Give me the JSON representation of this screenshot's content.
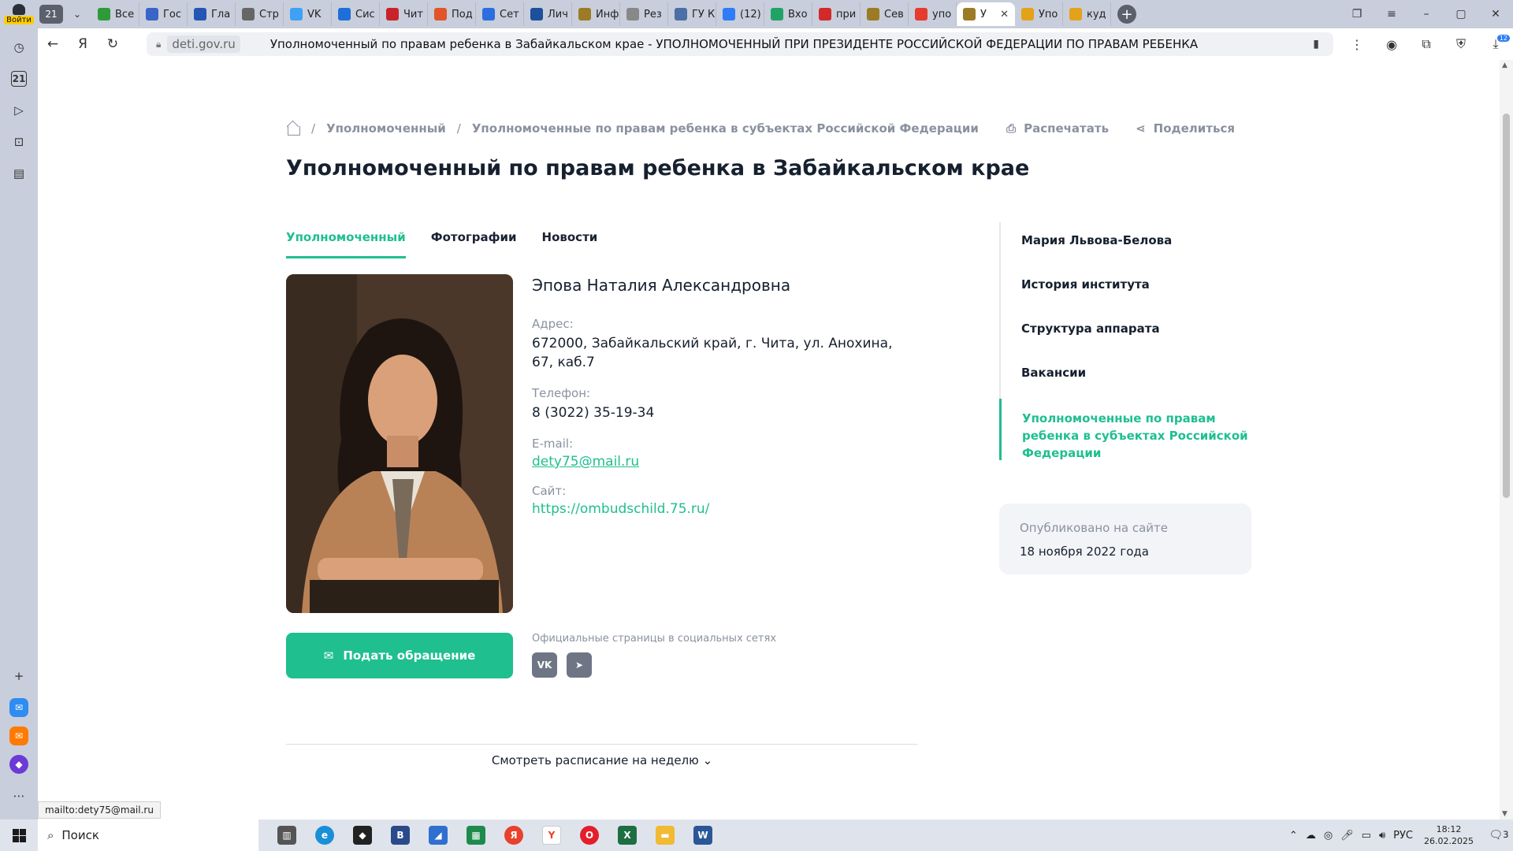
{
  "browser": {
    "login_label": "Войти",
    "tab_count": "21",
    "tabs": [
      {
        "label": "Все",
        "color": "#2d9b3a"
      },
      {
        "label": "Гос",
        "color": "#3a64c8"
      },
      {
        "label": "Гла",
        "color": "#2356b5"
      },
      {
        "label": "Стр",
        "color": "#666666"
      },
      {
        "label": "VK",
        "color": "#3da2f5"
      },
      {
        "label": "Сис",
        "color": "#1e6fd9"
      },
      {
        "label": "Чит",
        "color": "#c8232c"
      },
      {
        "label": "Под",
        "color": "#e2542a"
      },
      {
        "label": "Сет",
        "color": "#2c6ee0"
      },
      {
        "label": "Лич",
        "color": "#1d4f9c"
      },
      {
        "label": "Инф",
        "color": "#9c7b26"
      },
      {
        "label": "Рез",
        "color": "#888888"
      },
      {
        "label": "ГУ К",
        "color": "#4b6fa6"
      },
      {
        "label": "(12)",
        "color": "#2f7cf6"
      },
      {
        "label": "Вхо",
        "color": "#21a366"
      },
      {
        "label": "при",
        "color": "#d22a2a"
      },
      {
        "label": "Сев",
        "color": "#9c7b26"
      },
      {
        "label": "упо",
        "color": "#e63a2e"
      }
    ],
    "active_tab": {
      "label": "У"
    },
    "tabs_after": [
      {
        "label": "Упо",
        "color": "#e3a21a"
      },
      {
        "label": "куд",
        "color": "#e3a21a"
      }
    ],
    "domain": "deti.gov.ru",
    "page_title": "Уполномоченный по правам ребенка в Забайкальском крае - УПОЛНОМОЧЕННЫЙ ПРИ ПРЕЗИДЕНТЕ РОССИЙСКОЙ ФЕДЕРАЦИИ ПО ПРАВАМ РЕБЕНКА",
    "downloads_badge": "12",
    "status_url": "mailto:dety75@mail.ru",
    "sidebar_counter": "21"
  },
  "page": {
    "breadcrumbs": [
      "Уполномоченный",
      "Уполномоченные по правам ребенка в субъектах Российской Федерации"
    ],
    "print_label": "Распечатать",
    "share_label": "Поделиться",
    "title": "Уполномоченный по правам ребенка в Забайкальском крае",
    "tabs": [
      "Уполномоченный",
      "Фотографии",
      "Новости"
    ],
    "person": {
      "name": "Эпова Наталия Александровна",
      "address_label": "Адрес:",
      "address": "672000, Забайкальский край, г. Чита, ул. Анохина, 67, каб.7",
      "phone_label": "Телефон:",
      "phone": "8 (3022) 35-19-34",
      "email_label": "E-mail:",
      "email": "dety75@mail.ru",
      "site_label": "Сайт:",
      "site": "https://ombudschild.75.ru/"
    },
    "appeal_button": "Подать обращение",
    "social_label": "Официальные страницы в социальных сетях",
    "schedule_label": "Смотреть расписание на неделю",
    "sidebar_menu": [
      "Мария Львова-Белова",
      "История института",
      "Структура аппарата",
      "Вакансии",
      "Уполномоченные по правам ребенка в субъектах Российской Федерации"
    ],
    "published_label": "Опубликовано на сайте",
    "published_date": "18 ноября 2022 года",
    "accent": "#1fbf8f"
  },
  "taskbar": {
    "search_placeholder": "Поиск",
    "lang": "РУС",
    "time": "18:12",
    "date": "26.02.2025",
    "notif_count": "3"
  }
}
